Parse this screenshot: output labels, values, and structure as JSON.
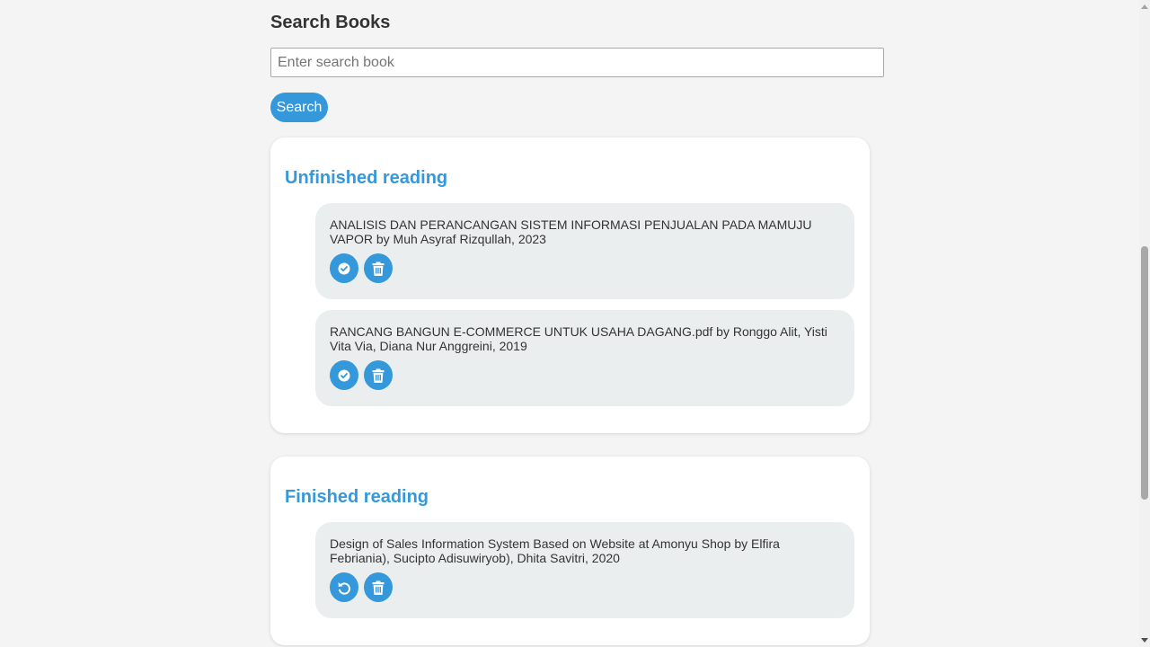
{
  "search": {
    "title": "Search Books",
    "placeholder": "Enter search book",
    "button_label": "Search"
  },
  "shelves": {
    "unfinished": {
      "title": "Unfinished reading",
      "books": [
        {
          "text": "ANALISIS DAN PERANCANGAN SISTEM INFORMASI PENJUALAN PADA MAMUJU VAPOR by Muh Asyraf Rizqullah, 2023",
          "actions": [
            "check-icon",
            "trash-icon"
          ]
        },
        {
          "text": "RANCANG BANGUN E-COMMERCE UNTUK USAHA DAGANG.pdf by Ronggo Alit, Yisti Vita Via, Diana Nur Anggreini, 2019",
          "actions": [
            "check-icon",
            "trash-icon"
          ]
        }
      ]
    },
    "finished": {
      "title": "Finished reading",
      "books": [
        {
          "text": "Design of Sales Information System Based on Website at Amonyu Shop by Elfira Febriania), Sucipto Adisuwiryob), Dhita Savitri, 2020",
          "actions": [
            "undo-icon",
            "trash-icon"
          ]
        }
      ]
    }
  },
  "colors": {
    "accent": "#3498db",
    "card_background": "#ffffff",
    "item_background": "#ebeeef",
    "page_background": "#f4f4f4"
  }
}
